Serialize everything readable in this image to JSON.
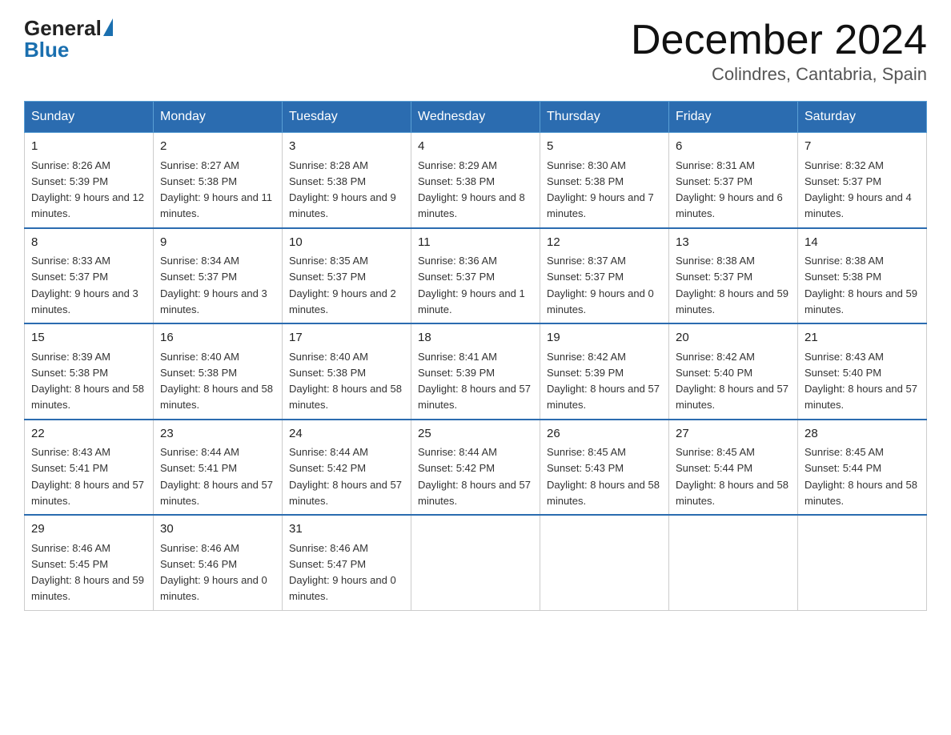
{
  "header": {
    "logo_general": "General",
    "logo_blue": "Blue",
    "title": "December 2024",
    "subtitle": "Colindres, Cantabria, Spain"
  },
  "calendar": {
    "days_of_week": [
      "Sunday",
      "Monday",
      "Tuesday",
      "Wednesday",
      "Thursday",
      "Friday",
      "Saturday"
    ],
    "weeks": [
      [
        {
          "day": "1",
          "sunrise": "8:26 AM",
          "sunset": "5:39 PM",
          "daylight": "9 hours and 12 minutes."
        },
        {
          "day": "2",
          "sunrise": "8:27 AM",
          "sunset": "5:38 PM",
          "daylight": "9 hours and 11 minutes."
        },
        {
          "day": "3",
          "sunrise": "8:28 AM",
          "sunset": "5:38 PM",
          "daylight": "9 hours and 9 minutes."
        },
        {
          "day": "4",
          "sunrise": "8:29 AM",
          "sunset": "5:38 PM",
          "daylight": "9 hours and 8 minutes."
        },
        {
          "day": "5",
          "sunrise": "8:30 AM",
          "sunset": "5:38 PM",
          "daylight": "9 hours and 7 minutes."
        },
        {
          "day": "6",
          "sunrise": "8:31 AM",
          "sunset": "5:37 PM",
          "daylight": "9 hours and 6 minutes."
        },
        {
          "day": "7",
          "sunrise": "8:32 AM",
          "sunset": "5:37 PM",
          "daylight": "9 hours and 4 minutes."
        }
      ],
      [
        {
          "day": "8",
          "sunrise": "8:33 AM",
          "sunset": "5:37 PM",
          "daylight": "9 hours and 3 minutes."
        },
        {
          "day": "9",
          "sunrise": "8:34 AM",
          "sunset": "5:37 PM",
          "daylight": "9 hours and 3 minutes."
        },
        {
          "day": "10",
          "sunrise": "8:35 AM",
          "sunset": "5:37 PM",
          "daylight": "9 hours and 2 minutes."
        },
        {
          "day": "11",
          "sunrise": "8:36 AM",
          "sunset": "5:37 PM",
          "daylight": "9 hours and 1 minute."
        },
        {
          "day": "12",
          "sunrise": "8:37 AM",
          "sunset": "5:37 PM",
          "daylight": "9 hours and 0 minutes."
        },
        {
          "day": "13",
          "sunrise": "8:38 AM",
          "sunset": "5:37 PM",
          "daylight": "8 hours and 59 minutes."
        },
        {
          "day": "14",
          "sunrise": "8:38 AM",
          "sunset": "5:38 PM",
          "daylight": "8 hours and 59 minutes."
        }
      ],
      [
        {
          "day": "15",
          "sunrise": "8:39 AM",
          "sunset": "5:38 PM",
          "daylight": "8 hours and 58 minutes."
        },
        {
          "day": "16",
          "sunrise": "8:40 AM",
          "sunset": "5:38 PM",
          "daylight": "8 hours and 58 minutes."
        },
        {
          "day": "17",
          "sunrise": "8:40 AM",
          "sunset": "5:38 PM",
          "daylight": "8 hours and 58 minutes."
        },
        {
          "day": "18",
          "sunrise": "8:41 AM",
          "sunset": "5:39 PM",
          "daylight": "8 hours and 57 minutes."
        },
        {
          "day": "19",
          "sunrise": "8:42 AM",
          "sunset": "5:39 PM",
          "daylight": "8 hours and 57 minutes."
        },
        {
          "day": "20",
          "sunrise": "8:42 AM",
          "sunset": "5:40 PM",
          "daylight": "8 hours and 57 minutes."
        },
        {
          "day": "21",
          "sunrise": "8:43 AM",
          "sunset": "5:40 PM",
          "daylight": "8 hours and 57 minutes."
        }
      ],
      [
        {
          "day": "22",
          "sunrise": "8:43 AM",
          "sunset": "5:41 PM",
          "daylight": "8 hours and 57 minutes."
        },
        {
          "day": "23",
          "sunrise": "8:44 AM",
          "sunset": "5:41 PM",
          "daylight": "8 hours and 57 minutes."
        },
        {
          "day": "24",
          "sunrise": "8:44 AM",
          "sunset": "5:42 PM",
          "daylight": "8 hours and 57 minutes."
        },
        {
          "day": "25",
          "sunrise": "8:44 AM",
          "sunset": "5:42 PM",
          "daylight": "8 hours and 57 minutes."
        },
        {
          "day": "26",
          "sunrise": "8:45 AM",
          "sunset": "5:43 PM",
          "daylight": "8 hours and 58 minutes."
        },
        {
          "day": "27",
          "sunrise": "8:45 AM",
          "sunset": "5:44 PM",
          "daylight": "8 hours and 58 minutes."
        },
        {
          "day": "28",
          "sunrise": "8:45 AM",
          "sunset": "5:44 PM",
          "daylight": "8 hours and 58 minutes."
        }
      ],
      [
        {
          "day": "29",
          "sunrise": "8:46 AM",
          "sunset": "5:45 PM",
          "daylight": "8 hours and 59 minutes."
        },
        {
          "day": "30",
          "sunrise": "8:46 AM",
          "sunset": "5:46 PM",
          "daylight": "9 hours and 0 minutes."
        },
        {
          "day": "31",
          "sunrise": "8:46 AM",
          "sunset": "5:47 PM",
          "daylight": "9 hours and 0 minutes."
        },
        null,
        null,
        null,
        null
      ]
    ],
    "sunrise_label": "Sunrise:",
    "sunset_label": "Sunset:",
    "daylight_label": "Daylight:"
  }
}
